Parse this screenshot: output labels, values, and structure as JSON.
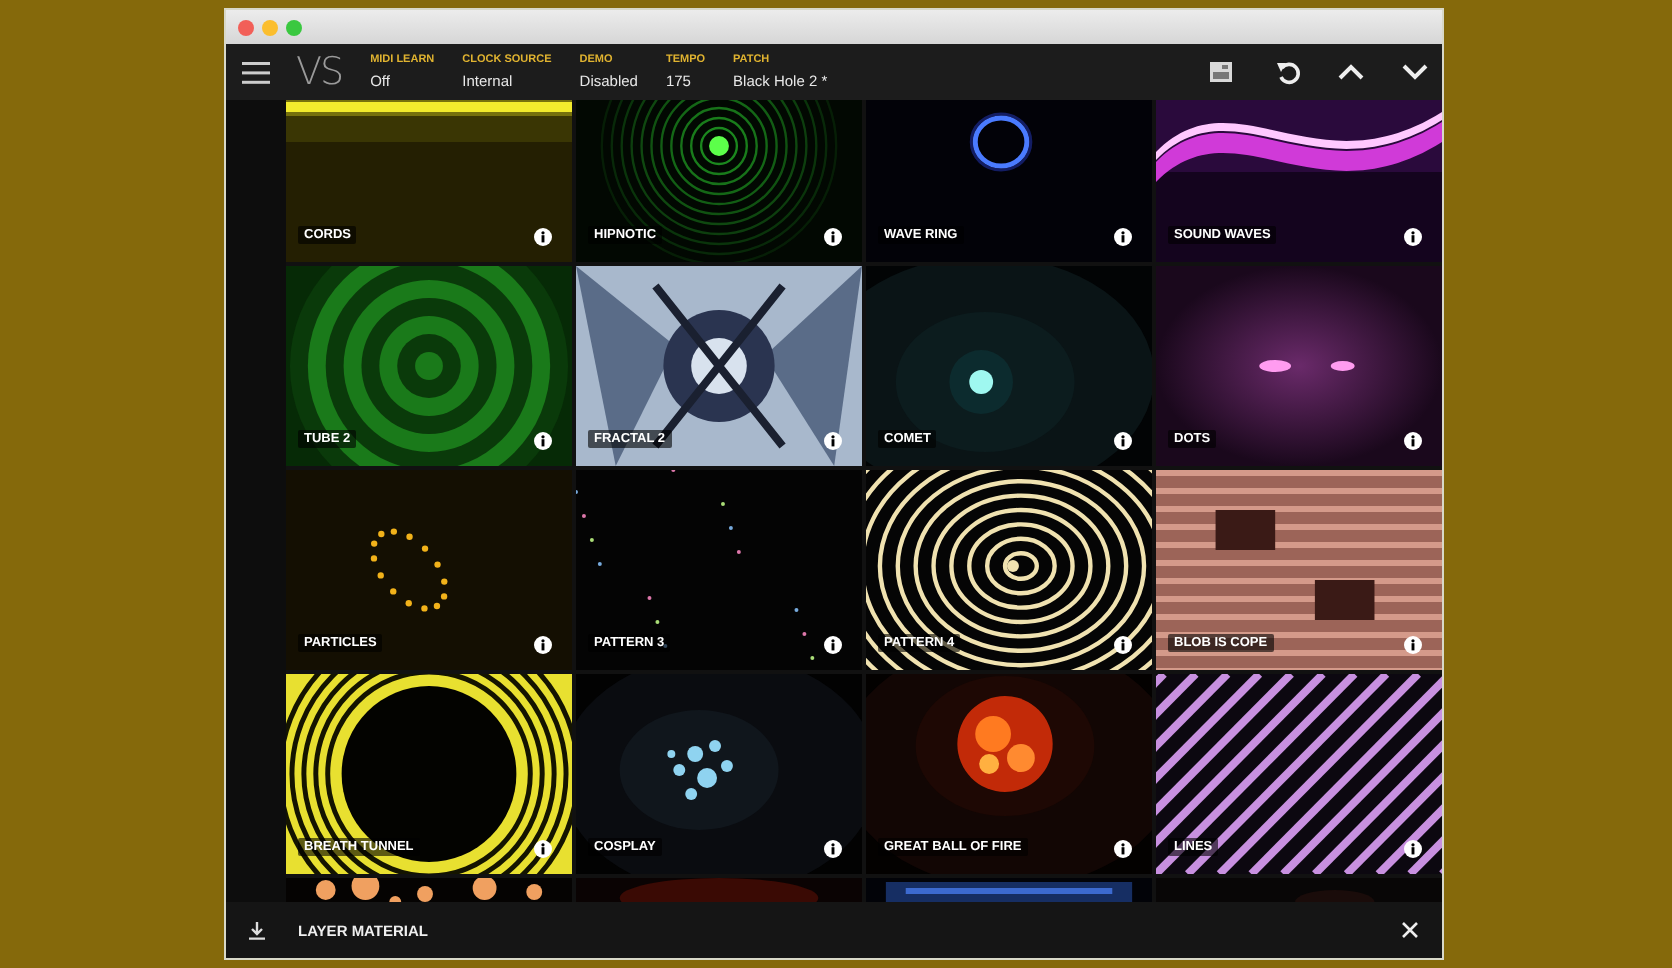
{
  "toolbar": {
    "logo": "VS",
    "fields": [
      {
        "label": "MIDI LEARN",
        "value": "Off"
      },
      {
        "label": "CLOCK SOURCE",
        "value": "Internal"
      },
      {
        "label": "DEMO",
        "value": "Disabled"
      },
      {
        "label": "TEMPO",
        "value": "175"
      },
      {
        "label": "PATCH",
        "value": "Black Hole 2 *"
      }
    ]
  },
  "tiles": [
    {
      "kind": "effect",
      "label": "CORDS"
    },
    {
      "kind": "effect",
      "label": "HIPNOTIC"
    },
    {
      "kind": "effect",
      "label": "WAVE RING"
    },
    {
      "kind": "effect",
      "label": "SOUND WAVES"
    },
    {
      "kind": "effect",
      "label": "TUBE 2"
    },
    {
      "kind": "effect",
      "label": "FRACTAL 2"
    },
    {
      "kind": "effect",
      "label": "COMET"
    },
    {
      "kind": "effect",
      "label": "DOTS"
    },
    {
      "kind": "effect",
      "label": "PARTICLES"
    },
    {
      "kind": "effect",
      "label": "PATTERN 3"
    },
    {
      "kind": "effect",
      "label": "PATTERN 4"
    },
    {
      "kind": "effect",
      "label": "BLOB IS COPE"
    },
    {
      "kind": "effect",
      "label": "BREATH TUNNEL"
    },
    {
      "kind": "effect",
      "label": "COSPLAY"
    },
    {
      "kind": "effect",
      "label": "GREAT BALL OF FIRE"
    },
    {
      "kind": "effect",
      "label": "LINES"
    },
    {
      "kind": "picture"
    },
    {
      "kind": "picture"
    },
    {
      "kind": "picture"
    },
    {
      "kind": "picture"
    }
  ],
  "bottom_bar": {
    "title": "LAYER MATERIAL"
  }
}
